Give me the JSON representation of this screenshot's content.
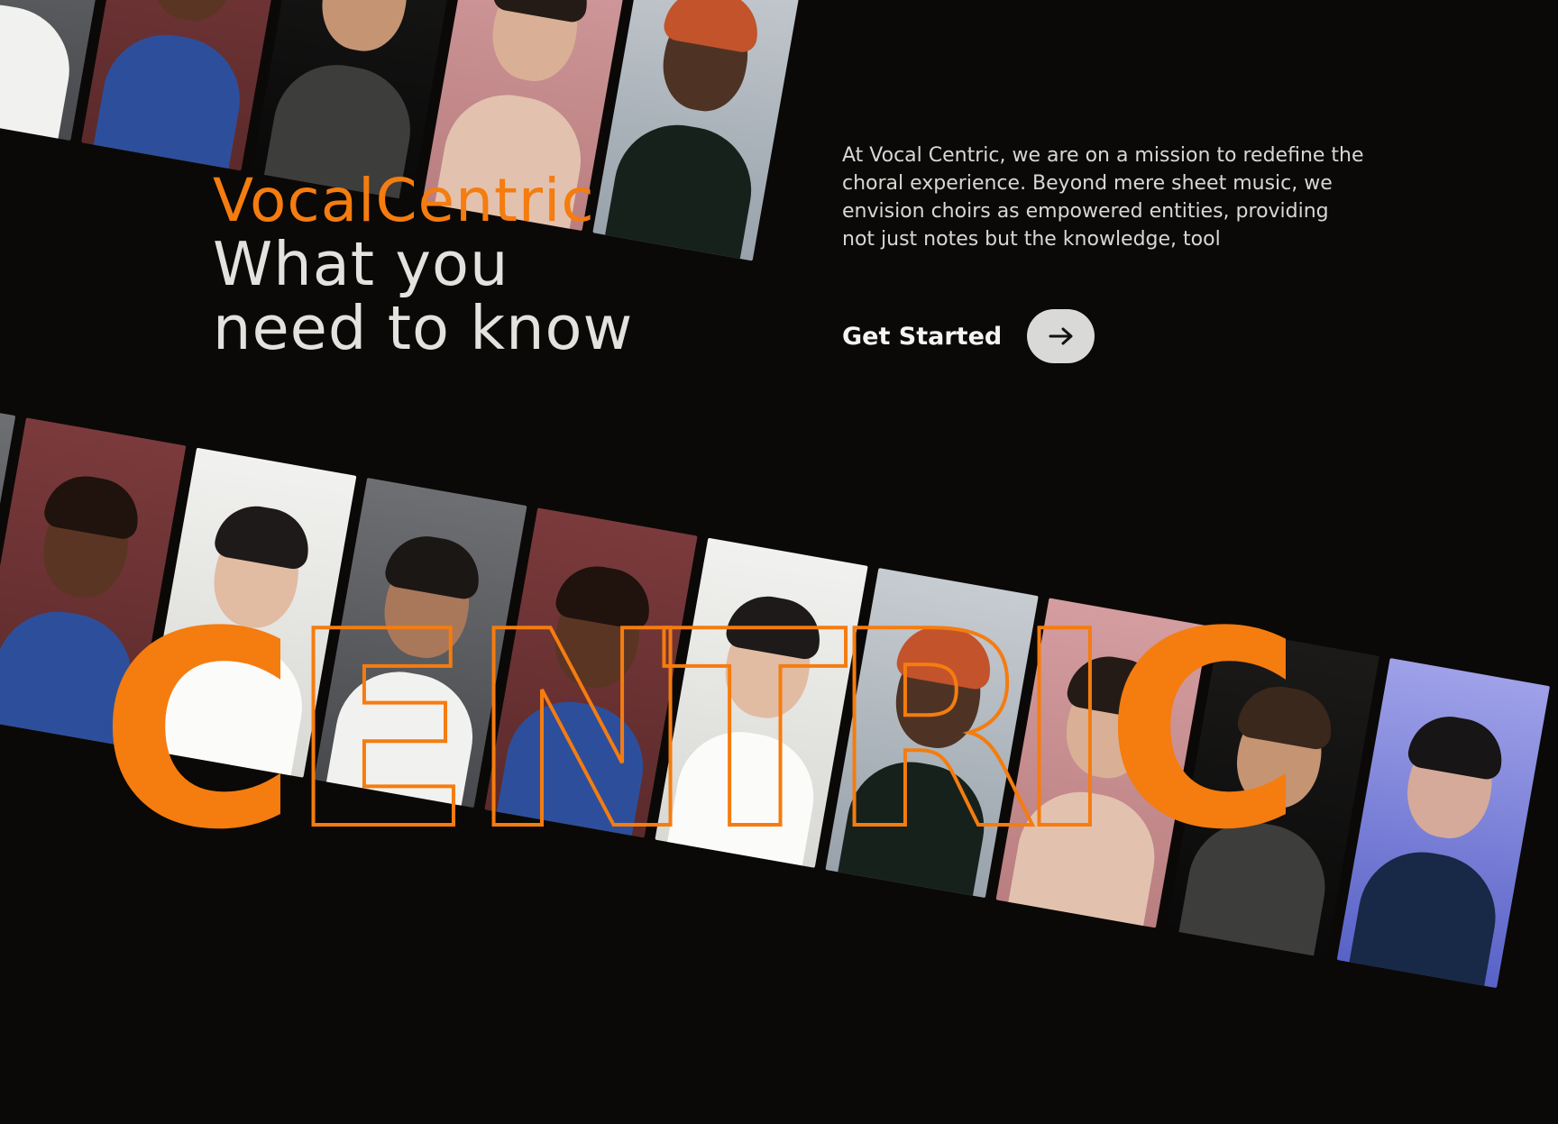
{
  "hero": {
    "brand": "VocalCentric",
    "heading_line_1": "What you",
    "heading_line_2": "need to know"
  },
  "mission": {
    "text": "At Vocal Centric, we are on a mission to redefine the choral experience. Beyond mere sheet music, we envision choirs as empowered entities, providing not just notes but the knowledge, tool"
  },
  "cta": {
    "label": "Get Started",
    "icon": "arrow-right-icon"
  },
  "banner": {
    "word": "CENTRIC",
    "letters": [
      "C",
      "E",
      "N",
      "T",
      "R",
      "I",
      "C"
    ]
  },
  "colors": {
    "accent": "#f57c0f",
    "background": "#0b0907",
    "text": "#e3e2df"
  }
}
